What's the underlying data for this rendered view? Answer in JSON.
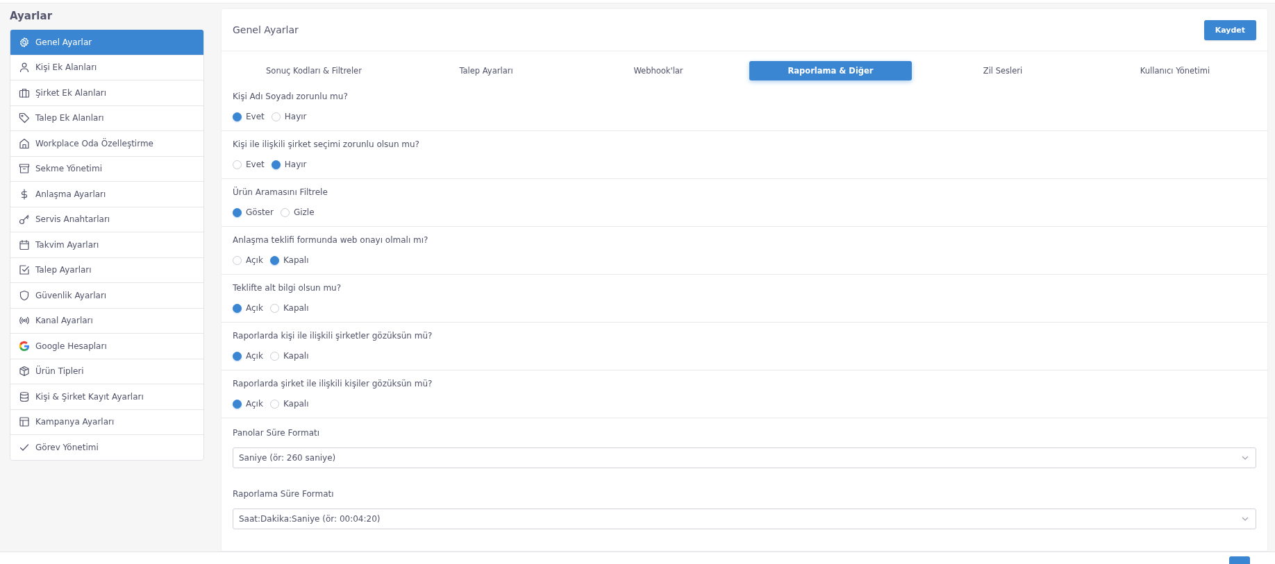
{
  "sidebar": {
    "title": "Ayarlar",
    "items": [
      {
        "label": "Genel Ayarlar",
        "selected": true
      },
      {
        "label": "Kişi Ek Alanları",
        "selected": false
      },
      {
        "label": "Şirket Ek Alanları",
        "selected": false
      },
      {
        "label": "Talep Ek Alanları",
        "selected": false
      },
      {
        "label": "Workplace Oda Özelleştirme",
        "selected": false
      },
      {
        "label": "Sekme Yönetimi",
        "selected": false
      },
      {
        "label": "Anlaşma Ayarları",
        "selected": false
      },
      {
        "label": "Servis Anahtarları",
        "selected": false
      },
      {
        "label": "Takvim Ayarları",
        "selected": false
      },
      {
        "label": "Talep Ayarları",
        "selected": false
      },
      {
        "label": "Güvenlik Ayarları",
        "selected": false
      },
      {
        "label": "Kanal Ayarları",
        "selected": false
      },
      {
        "label": "Google Hesapları",
        "selected": false
      },
      {
        "label": "Ürün Tipleri",
        "selected": false
      },
      {
        "label": "Kişi & Şirket Kayıt Ayarları",
        "selected": false
      },
      {
        "label": "Kampanya Ayarları",
        "selected": false
      },
      {
        "label": "Görev Yönetimi",
        "selected": false
      }
    ]
  },
  "header": {
    "title": "Genel Ayarlar",
    "save_button": "Kaydet"
  },
  "tabs": [
    {
      "label": "Sonuç Kodları & Filtreler",
      "selected": false
    },
    {
      "label": "Talep Ayarları",
      "selected": false
    },
    {
      "label": "Webhook'lar",
      "selected": false
    },
    {
      "label": "Raporlama & Diğer",
      "selected": true
    },
    {
      "label": "Zil Sesleri",
      "selected": false
    },
    {
      "label": "Kullanıcı Yönetimi",
      "selected": false
    }
  ],
  "settings": [
    {
      "kind": "radio",
      "question": "Kişi Adı Soyadı zorunlu mu?",
      "options": [
        {
          "label": "Evet",
          "selected": true
        },
        {
          "label": "Hayır",
          "selected": false
        }
      ]
    },
    {
      "kind": "radio",
      "question": "Kişi ile ilişkili şirket seçimi zorunlu olsun mu?",
      "options": [
        {
          "label": "Evet",
          "selected": false
        },
        {
          "label": "Hayır",
          "selected": true
        }
      ]
    },
    {
      "kind": "radio",
      "question": "Ürün Aramasını Filtrele",
      "options": [
        {
          "label": "Göster",
          "selected": true
        },
        {
          "label": "Gizle",
          "selected": false
        }
      ]
    },
    {
      "kind": "radio",
      "question": "Anlaşma teklifi formunda web onayı olmalı mı?",
      "options": [
        {
          "label": "Açık",
          "selected": false
        },
        {
          "label": "Kapalı",
          "selected": true
        }
      ]
    },
    {
      "kind": "radio",
      "question": "Teklifte alt bilgi olsun mu?",
      "options": [
        {
          "label": "Açık",
          "selected": true
        },
        {
          "label": "Kapalı",
          "selected": false
        }
      ]
    },
    {
      "kind": "radio",
      "question": "Raporlarda kişi ile ilişkili şirketler gözüksün mü?",
      "options": [
        {
          "label": "Açık",
          "selected": true
        },
        {
          "label": "Kapalı",
          "selected": false
        }
      ]
    },
    {
      "kind": "radio",
      "question": "Raporlarda şirket ile ilişkili kişiler gözüksün mü?",
      "options": [
        {
          "label": "Açık",
          "selected": true
        },
        {
          "label": "Kapalı",
          "selected": false
        }
      ]
    },
    {
      "kind": "select",
      "question": "Panolar Süre Formatı",
      "value": "Saniye (ör: 260 saniye)"
    },
    {
      "kind": "select",
      "question": "Raporlama Süre Formatı",
      "value": "Saat:Dakika:Saniye (ör: 00:04:20)"
    }
  ]
}
